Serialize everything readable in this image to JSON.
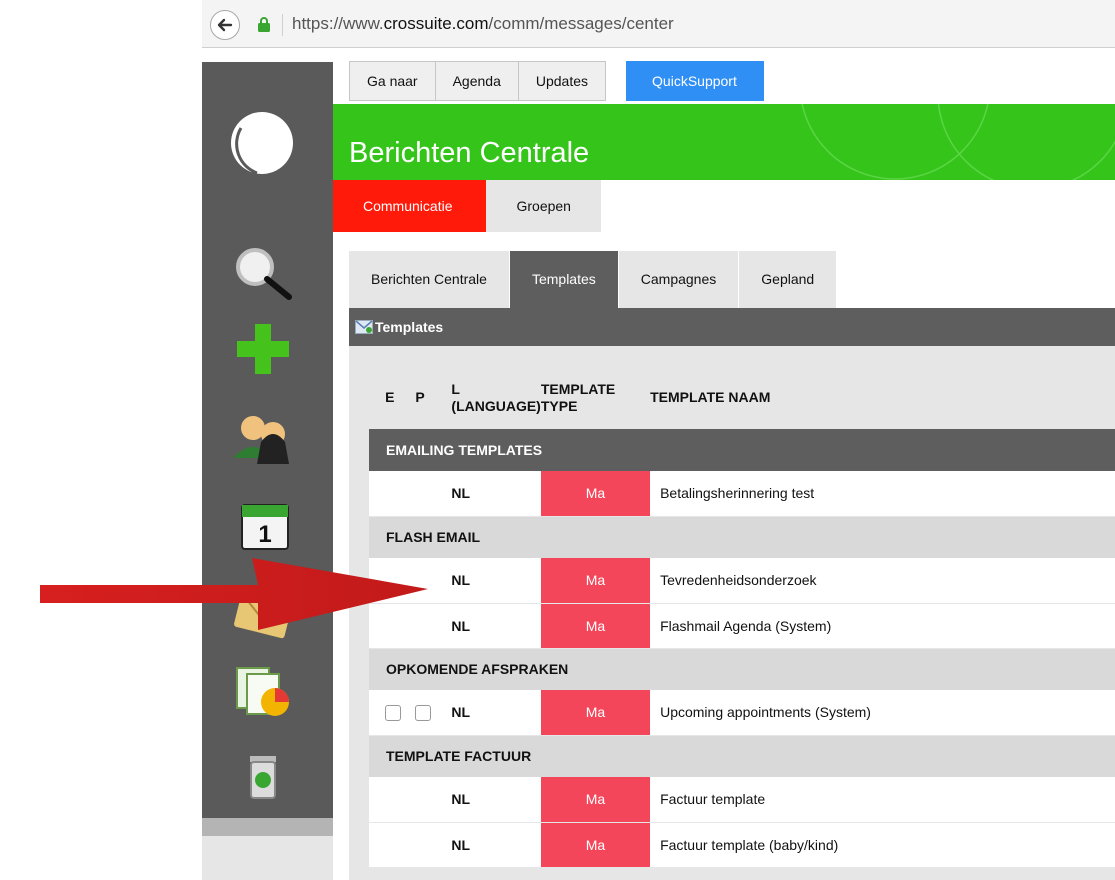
{
  "browser": {
    "url_prefix": "https://www.",
    "url_host": "crossuite.com",
    "url_path": "/comm/messages/center"
  },
  "topmenu": [
    {
      "label": "Ga naar"
    },
    {
      "label": "Agenda"
    },
    {
      "label": "Updates"
    }
  ],
  "quicksupport_label": "QuickSupport",
  "header_title": "Berichten Centrale",
  "subnav": {
    "active": "Communicatie",
    "inactive": "Groepen"
  },
  "tabs": [
    {
      "label": "Berichten Centrale",
      "active": false
    },
    {
      "label": "Templates",
      "active": true
    },
    {
      "label": "Campagnes",
      "active": false
    },
    {
      "label": "Gepland",
      "active": false
    }
  ],
  "panel_title": "Templates",
  "columns": {
    "e": "E",
    "p": "P",
    "lang_line1": "L",
    "lang_line2": "(LANGUAGE)",
    "type_line1": "TEMPLATE",
    "type_line2": "TYPE",
    "name": "TEMPLATE NAAM"
  },
  "groups": [
    {
      "title": "EMAILING TEMPLATES",
      "rows": [
        {
          "lang": "NL",
          "type": "Ma",
          "name": "Betalingsherinnering test",
          "checkboxes": false
        }
      ]
    },
    {
      "title": "FLASH EMAIL",
      "rows": [
        {
          "lang": "NL",
          "type": "Ma",
          "name": "Tevredenheidsonderzoek",
          "checkboxes": false
        },
        {
          "lang": "NL",
          "type": "Ma",
          "name": "Flashmail Agenda (System)",
          "checkboxes": false
        }
      ]
    },
    {
      "title": "OPKOMENDE AFSPRAKEN",
      "rows": [
        {
          "lang": "NL",
          "type": "Ma",
          "name": "Upcoming appointments (System)",
          "checkboxes": true
        }
      ]
    },
    {
      "title": "TEMPLATE FACTUUR",
      "rows": [
        {
          "lang": "NL",
          "type": "Ma",
          "name": "Factuur template",
          "checkboxes": false
        },
        {
          "lang": "NL",
          "type": "Ma",
          "name": "Factuur template (baby/kind)",
          "checkboxes": false
        }
      ]
    }
  ],
  "colors": {
    "header_green": "#35c51a",
    "active_subnav_red": "#ff1a0a",
    "type_badge_red": "#f4465a",
    "quicksupport_blue": "#2f8ff5",
    "annotation_arrow_red": "#d71f1f"
  },
  "sidebar_icons": [
    "logo-icon",
    "search-icon",
    "add-icon",
    "users-icon",
    "calendar-icon",
    "mail-icon",
    "reports-icon",
    "trash-icon"
  ]
}
